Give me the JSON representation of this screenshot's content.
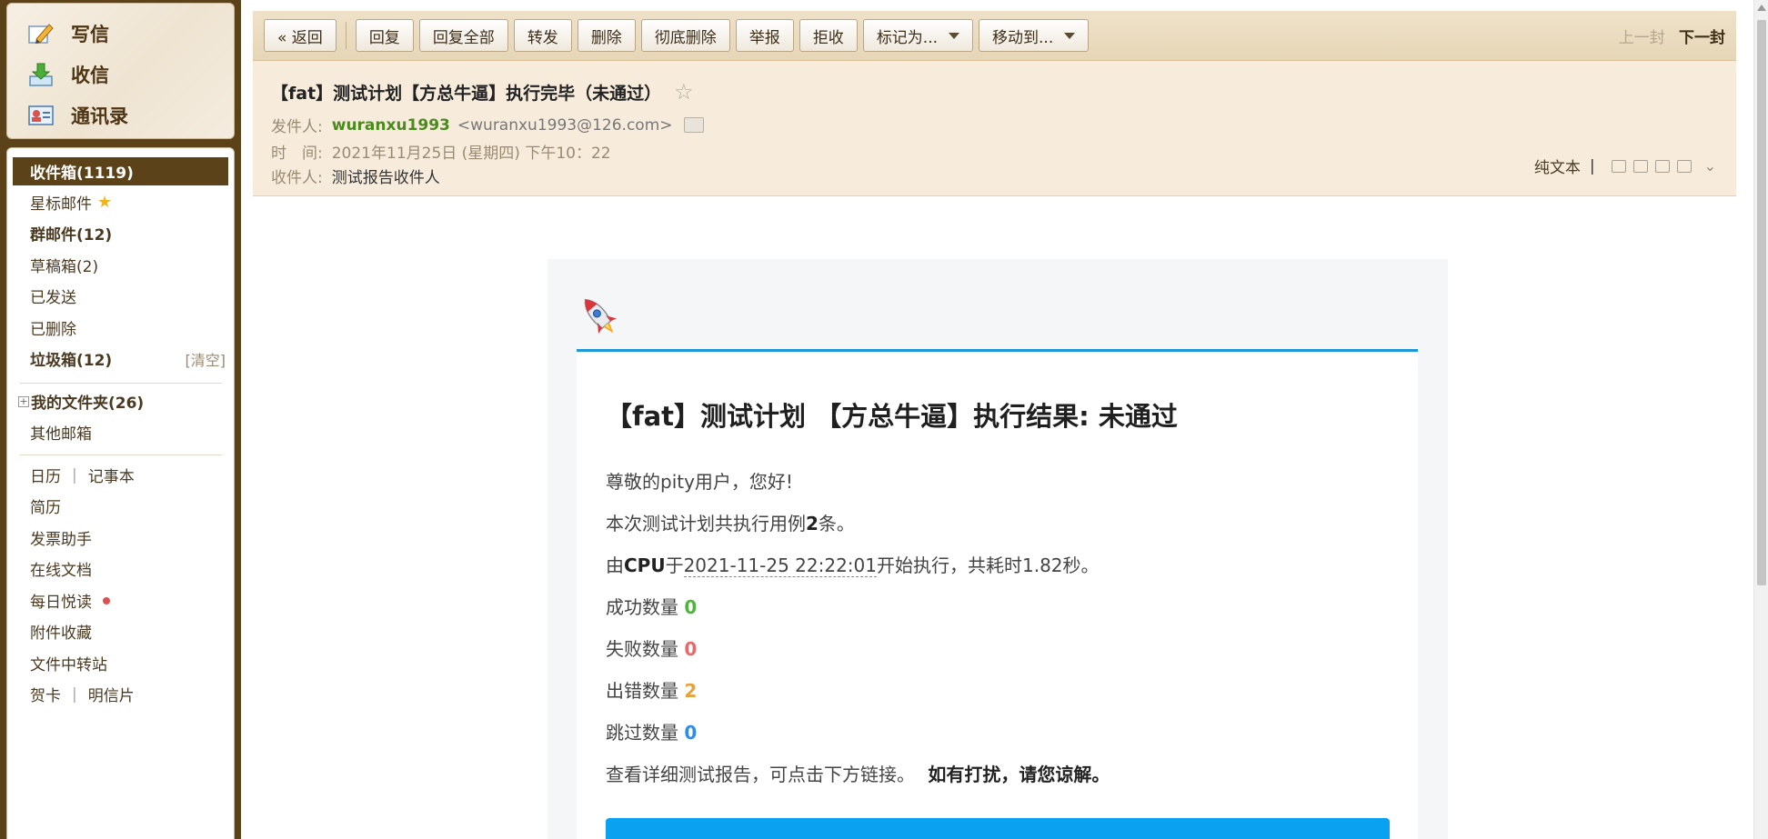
{
  "quick_actions": [
    {
      "label": "写信",
      "icon": "compose-icon"
    },
    {
      "label": "收信",
      "icon": "receive-icon"
    },
    {
      "label": "通讯录",
      "icon": "contacts-icon"
    }
  ],
  "folders": {
    "inbox": "收件箱(1119)",
    "starred": "星标邮件",
    "group": "群邮件(12)",
    "drafts": "草稿箱(2)",
    "sent": "已发送",
    "deleted": "已删除",
    "spam": "垃圾箱(12)",
    "spam_clear": "[清空]",
    "my_folders": "我的文件夹(26)",
    "other": "其他邮箱"
  },
  "tools": {
    "calendar": "日历",
    "notebook": "记事本",
    "resume": "简历",
    "invoice": "发票助手",
    "docs": "在线文档",
    "daily": "每日悦读",
    "attachments": "附件收藏",
    "transfer": "文件中转站",
    "greeting": "贺卡",
    "postcard": "明信片"
  },
  "toolbar": {
    "back": "« 返回",
    "reply": "回复",
    "reply_all": "回复全部",
    "forward": "转发",
    "delete": "删除",
    "delete_forever": "彻底删除",
    "report": "举报",
    "reject": "拒收",
    "mark_as": "标记为...",
    "move_to": "移动到...",
    "prev": "上一封",
    "next": "下一封"
  },
  "header": {
    "subject": "【fat】测试计划【方总牛逼】执行完毕（未通过）",
    "sender_label": "发件人:",
    "sender_name": "wuranxu1993",
    "sender_email": "<wuranxu1993@126.com>",
    "time_label": "时　间:",
    "time": "2021年11月25日 (星期四) 下午10：22",
    "recipient_label": "收件人:",
    "recipient": "测试报告收件人",
    "plain_text": "纯文本"
  },
  "body": {
    "title": "【fat】测试计划 【方总牛逼】执行结果: 未通过",
    "greeting": "尊敬的pity用户，您好!",
    "case_prefix": "本次测试计划共执行用例",
    "case_count": "2",
    "case_suffix": "条。",
    "exec_prefix": "由",
    "executor": "CPU",
    "exec_mid": "于",
    "start_time": "2021-11-25 22:22:01",
    "exec_suffix": "开始执行，共耗时1.82秒。",
    "success_label": "成功数量",
    "success": "0",
    "failed_label": "失败数量",
    "failed": "0",
    "error_label": "出错数量",
    "error": "2",
    "skipped_label": "跳过数量",
    "skipped": "0",
    "detail_text": "查看详细测试报告，可点击下方链接。",
    "apology": "如有打扰，请您谅解。"
  },
  "colors": {
    "brand_dark": "#5b4219",
    "success": "#52b33f",
    "failed": "#e76a6a",
    "error": "#e9a13b",
    "skipped": "#2f8bee",
    "report_button": "#0aa2f0"
  }
}
